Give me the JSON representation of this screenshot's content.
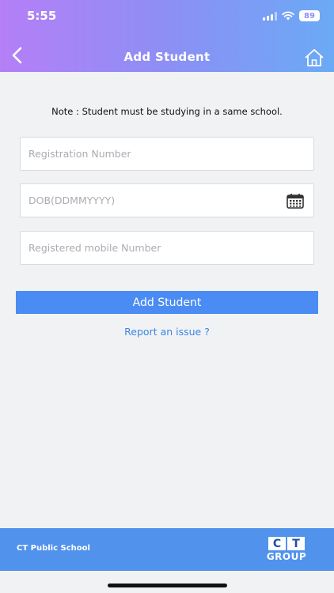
{
  "status_bar": {
    "time": "5:55",
    "battery": "89"
  },
  "header": {
    "title": "Add Student",
    "back_icon": "chevron-left-icon",
    "home_icon": "home-icon"
  },
  "note": "Note : Student must be studying in a same school.",
  "form": {
    "registration_placeholder": "Registration Number",
    "dob_placeholder": "DOB(DDMMYYYY)",
    "mobile_placeholder": "Registered mobile Number",
    "calendar_icon": "calendar-icon",
    "submit_label": "Add Student"
  },
  "report_link": "Report an issue ?",
  "footer": {
    "school_name": "CT Public School",
    "logo_letters": [
      "C",
      "T"
    ],
    "logo_group": "GROUP"
  },
  "colors": {
    "header_start": "#b57ff6",
    "header_end": "#6aaaf5",
    "button": "#4a8cf3",
    "link": "#3b86e4",
    "footer": "#5193ec"
  }
}
